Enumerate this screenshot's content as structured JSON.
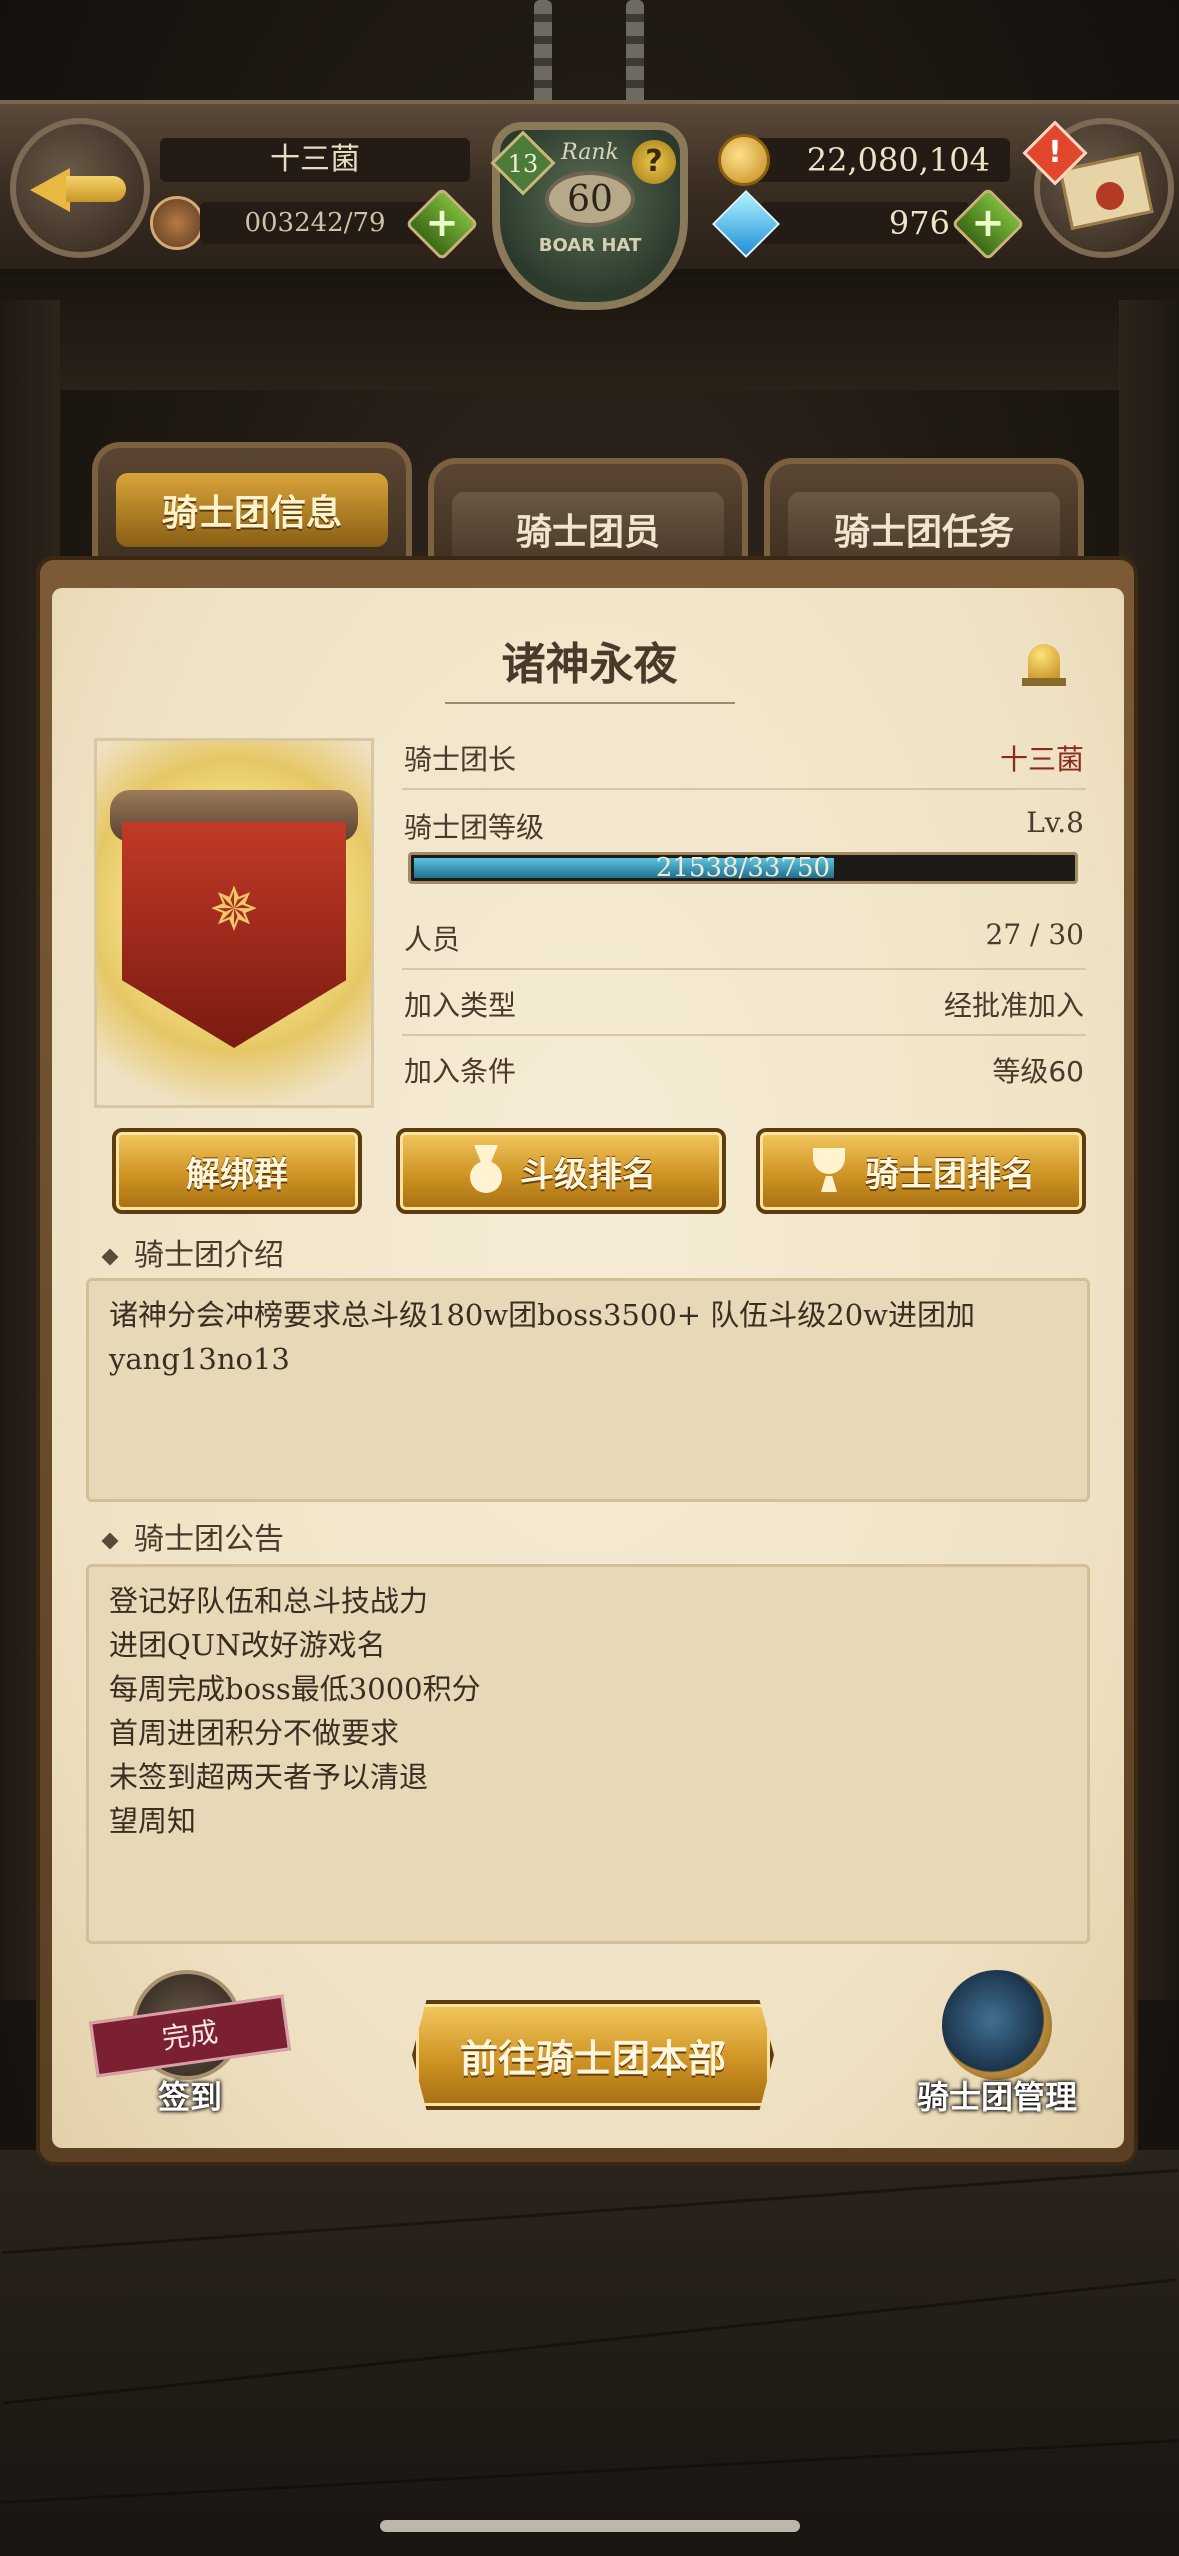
{
  "header": {
    "player_name": "十三菌",
    "stamina": "003242/79",
    "rank_label": "Rank",
    "rank_value": "60",
    "rank_badge": "13",
    "rank_subtitle": "BOAR HAT",
    "gold": "22,080,104",
    "gems": "976",
    "plus_symbol": "+",
    "alert_symbol": "!",
    "help_symbol": "?"
  },
  "tabs": [
    {
      "label": "骑士团信息",
      "active": true
    },
    {
      "label": "骑士团员",
      "active": false
    },
    {
      "label": "骑士团任务",
      "active": false
    }
  ],
  "guild": {
    "name": "诸神永夜",
    "leader_label": "骑士团长",
    "leader_value": "十三菌",
    "level_label": "骑士团等级",
    "level_value": "Lv.8",
    "exp_text": "21538/33750",
    "exp_fraction": 0.638,
    "members_label": "人员",
    "members_value": "27 / 30",
    "join_type_label": "加入类型",
    "join_type_value": "经批准加入",
    "join_req_label": "加入条件",
    "join_req_value": "等级60"
  },
  "buttons": {
    "unbind": "解绑群",
    "fight_rank": "斗级排名",
    "guild_rank": "骑士团排名",
    "go_hq": "前往骑士团本部"
  },
  "intro": {
    "title": "骑士团介绍",
    "text": "诸神分会冲榜要求总斗级180w团boss3500+ 队伍斗级20w进团加yang13no13"
  },
  "notice": {
    "title": "骑士团公告",
    "lines": [
      "登记好队伍和总斗技战力",
      "进团QUN改好游戏名",
      "每周完成boss最低3000积分",
      "首周进团积分不做要求",
      "未签到超两天者予以清退",
      "望周知"
    ]
  },
  "signin": {
    "stamp": "完成",
    "label": "签到"
  },
  "manage": {
    "label": "骑士团管理"
  },
  "icons": {
    "back": "back-arrow-icon",
    "mail": "mail-icon",
    "bell": "bell-icon",
    "gold": "gold-coin-icon",
    "gem": "gem-icon",
    "medal": "medal-icon",
    "trophy": "trophy-icon"
  },
  "colors": {
    "accent_gold": "#cf9424",
    "paper": "#efe2c4",
    "exp_bar": "#1f6f8e",
    "leader_name": "#8c2a1c"
  }
}
